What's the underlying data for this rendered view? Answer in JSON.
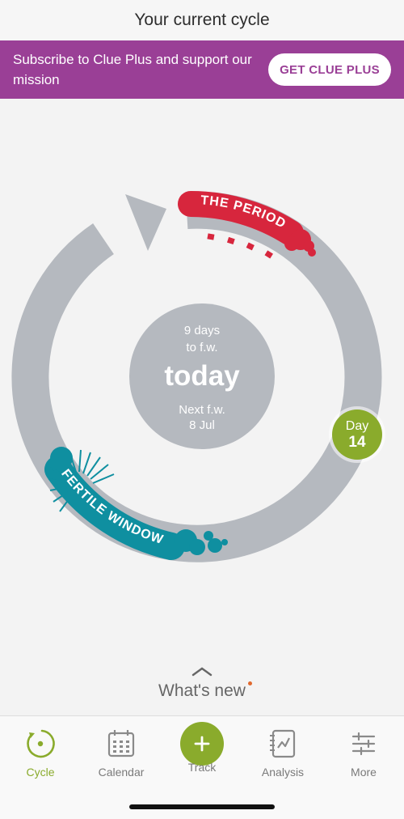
{
  "header": {
    "title": "Your current cycle"
  },
  "banner": {
    "text": "Subscribe to Clue Plus and support our mission",
    "button_label": "GET CLUE PLUS",
    "color": "#9a3f96"
  },
  "cycle": {
    "center": {
      "days_line1": "9 days",
      "days_line2": "to f.w.",
      "today_label": "today",
      "next_line1": "Next f.w.",
      "next_line2": "8 Jul"
    },
    "period_label": "THE PERIOD",
    "fertile_label": "FERTILE WINDOW",
    "day_marker": {
      "label": "Day",
      "number": "14"
    },
    "colors": {
      "ring": "#b5b9bf",
      "period": "#d7263d",
      "fertile": "#0f8fa0",
      "day_marker": "#8aab2c"
    }
  },
  "whats_new": {
    "label": "What's new"
  },
  "tabs": [
    {
      "label": "Cycle",
      "icon": "cycle-icon",
      "active": true
    },
    {
      "label": "Calendar",
      "icon": "calendar-icon",
      "active": false
    },
    {
      "label": "Track",
      "icon": "plus-icon",
      "active": false
    },
    {
      "label": "Analysis",
      "icon": "analysis-icon",
      "active": false
    },
    {
      "label": "More",
      "icon": "sliders-icon",
      "active": false
    }
  ]
}
